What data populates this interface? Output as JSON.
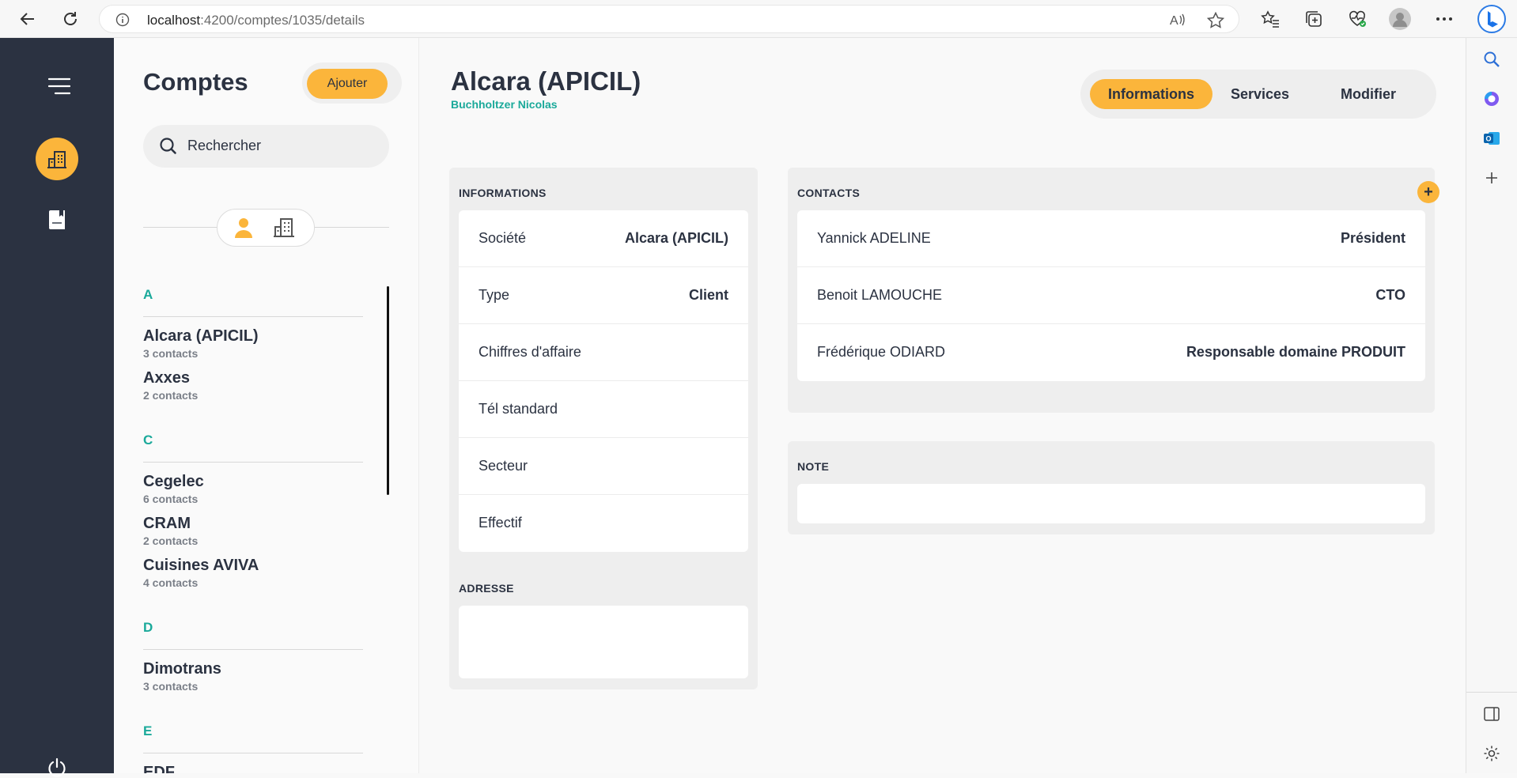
{
  "browser": {
    "url_host": "localhost",
    "url_path": ":4200/comptes/1035/details"
  },
  "list": {
    "title": "Comptes",
    "add_label": "Ajouter",
    "search_placeholder": "Rechercher",
    "groups": [
      {
        "letter": "A",
        "accounts": [
          {
            "name": "Alcara (APICIL)",
            "count": "3 contacts"
          },
          {
            "name": "Axxes",
            "count": "2 contacts"
          }
        ]
      },
      {
        "letter": "C",
        "accounts": [
          {
            "name": "Cegelec",
            "count": "6 contacts"
          },
          {
            "name": "CRAM",
            "count": "2 contacts"
          },
          {
            "name": "Cuisines AVIVA",
            "count": "4 contacts"
          }
        ]
      },
      {
        "letter": "D",
        "accounts": [
          {
            "name": "Dimotrans",
            "count": "3 contacts"
          }
        ]
      },
      {
        "letter": "E",
        "accounts": [
          {
            "name": "EDF",
            "count": ""
          }
        ]
      }
    ]
  },
  "header": {
    "title": "Alcara (APICIL)",
    "subtitle": "Buchholtzer Nicolas",
    "tabs": [
      {
        "label": "Informations",
        "active": true
      },
      {
        "label": "Services",
        "active": false
      },
      {
        "label": "Modifier",
        "active": false
      }
    ]
  },
  "informations": {
    "heading": "INFORMATIONS",
    "rows": [
      {
        "label": "Société",
        "value": "Alcara (APICIL)"
      },
      {
        "label": "Type",
        "value": "Client"
      },
      {
        "label": "Chiffres d'affaire",
        "value": ""
      },
      {
        "label": "Tél standard",
        "value": ""
      },
      {
        "label": "Secteur",
        "value": ""
      },
      {
        "label": "Effectif",
        "value": ""
      }
    ]
  },
  "adresse": {
    "heading": "ADRESSE",
    "value": ""
  },
  "contacts": {
    "heading": "CONTACTS",
    "add_symbol": "+",
    "rows": [
      {
        "name": "Yannick ADELINE",
        "role": "Président"
      },
      {
        "name": "Benoit LAMOUCHE",
        "role": "CTO"
      },
      {
        "name": "Frédérique ODIARD",
        "role": "Responsable domaine PRODUIT"
      }
    ]
  },
  "note": {
    "heading": "NOTE",
    "value": ""
  },
  "colors": {
    "accent": "#fbb53b",
    "teal": "#1aa99a",
    "navy": "#2b3241"
  },
  "icons": [
    "back-icon",
    "reload-icon",
    "info-icon",
    "read-aloud-icon",
    "star-icon",
    "favorites-icon",
    "collections-icon",
    "health-icon",
    "profile-icon",
    "more-icon",
    "bing-icon",
    "menu-icon",
    "accounts-icon",
    "book-icon",
    "power-icon",
    "person-icon",
    "building-icon",
    "search-icon",
    "plus-icon"
  ]
}
